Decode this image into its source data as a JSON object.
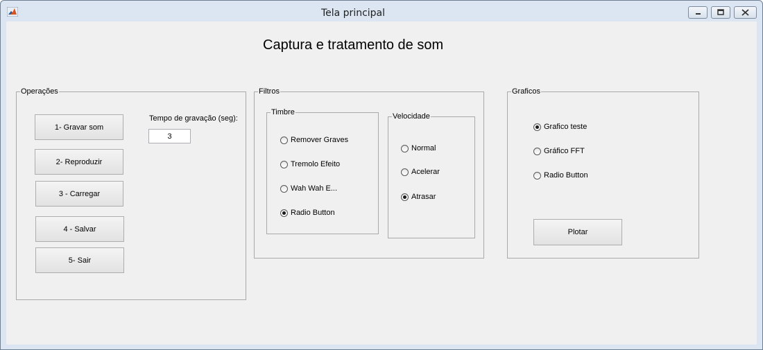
{
  "window": {
    "title": "Tela principal",
    "controls": {
      "minimize": "minimize-icon",
      "restore": "restore-icon",
      "close": "close-icon"
    }
  },
  "main_title": "Captura e tratamento de som",
  "operacoes": {
    "title": "Operações",
    "buttons": [
      "1- Gravar som",
      "2- Reproduzir",
      "3 - Carregar",
      "4 - Salvar",
      "5- Sair"
    ],
    "tempo_label": "Tempo de gravação (seg):",
    "tempo_value": "3"
  },
  "filtros": {
    "title": "Filtros",
    "timbre": {
      "title": "Timbre",
      "options": [
        {
          "label": "Remover Graves",
          "selected": false
        },
        {
          "label": "Tremolo Efeito",
          "selected": false
        },
        {
          "label": "Wah Wah E...",
          "selected": false
        },
        {
          "label": "Radio Button",
          "selected": true
        }
      ]
    },
    "velocidade": {
      "title": "Velocidade",
      "options": [
        {
          "label": "Normal",
          "selected": false
        },
        {
          "label": "Acelerar",
          "selected": false
        },
        {
          "label": "Atrasar",
          "selected": true
        }
      ]
    }
  },
  "graficos": {
    "title": "Graficos",
    "options": [
      {
        "label": "Grafico teste",
        "selected": true
      },
      {
        "label": "Gráfico FFT",
        "selected": false
      },
      {
        "label": "Radio Button",
        "selected": false
      }
    ],
    "plot_button": "Plotar"
  },
  "colors": {
    "frame": "#dbe6f2",
    "client": "#f0f0f0",
    "border": "#a9a9a9"
  }
}
